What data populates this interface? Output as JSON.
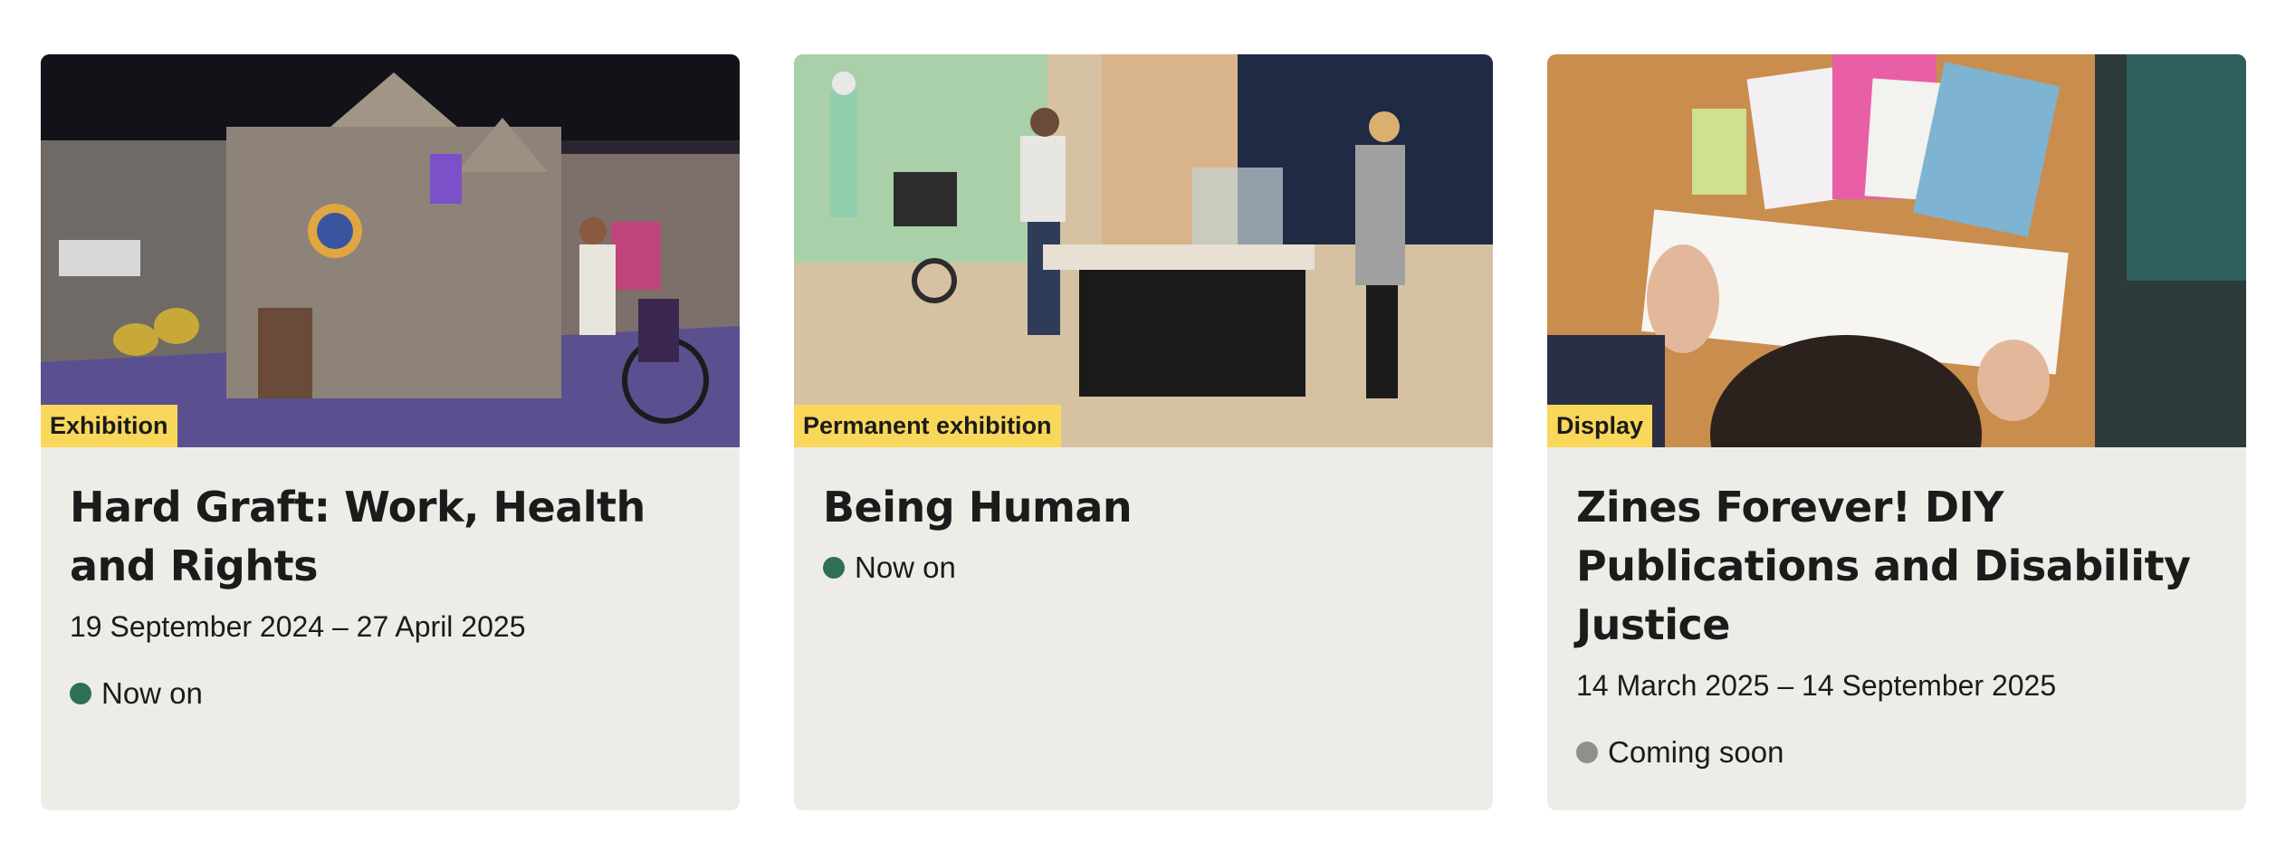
{
  "colors": {
    "card_background": "#edece7",
    "label_background": "#f8d75b",
    "status_now_on": "#2f6f55",
    "status_coming_soon": "#8f8f8f",
    "text": "#1b1b1b"
  },
  "cards": [
    {
      "label": "Exhibition",
      "title": "Hard Graft: Work, Health and Rights",
      "dates": "19 September 2024 – 27 April 2025",
      "status": "Now on",
      "status_type": "now-on"
    },
    {
      "label": "Permanent exhibition",
      "title": "Being Human",
      "dates": "",
      "status": "Now on",
      "status_type": "now-on"
    },
    {
      "label": "Display",
      "title": "Zines Forever! DIY Publications and Disability Justice",
      "dates": "14 March 2025 – 14 September 2025",
      "status": "Coming soon",
      "status_type": "coming-soon"
    }
  ]
}
